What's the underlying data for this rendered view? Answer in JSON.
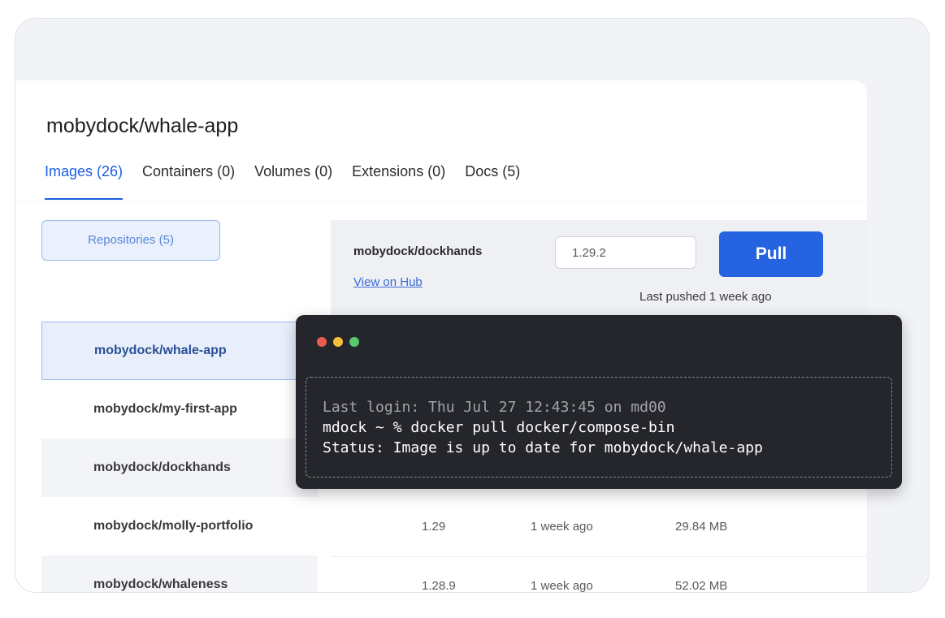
{
  "app": {
    "title": "mobydock/whale-app"
  },
  "tabs": [
    {
      "label": "Images (26)",
      "active": true
    },
    {
      "label": "Containers (0)"
    },
    {
      "label": "Volumes (0)"
    },
    {
      "label": "Extensions (0)"
    },
    {
      "label": "Docs (5)"
    }
  ],
  "sidebar": {
    "repositories_button": "Repositories (5)",
    "items": [
      {
        "label": "mobydock/whale-app"
      },
      {
        "label": "mobydock/my-first-app"
      },
      {
        "label": "mobydock/dockhands"
      },
      {
        "label": "mobydock/molly-portfolio"
      },
      {
        "label": "mobydock/whaleness"
      }
    ]
  },
  "detail": {
    "name": "mobydock/dockhands",
    "link": "View on Hub",
    "version_value": "1.29.2",
    "pull_label": "Pull",
    "last_pushed": "Last pushed 1 week ago"
  },
  "table": {
    "rows": [
      {
        "version": "1.29",
        "pushed": "1 week ago",
        "size": "29.84 MB"
      },
      {
        "version": "1.28.9",
        "pushed": "1 week ago",
        "size": "52.02 MB"
      }
    ]
  },
  "terminal": {
    "lines": [
      "Last login: Thu Jul 27 12:43:45 on md00",
      "mdock ~ % docker pull docker/compose-bin",
      "Status: Image is up to date for mobydock/whale-app"
    ]
  },
  "colors": {
    "accent": "#2563e0",
    "terminal_bg": "#25262b"
  }
}
